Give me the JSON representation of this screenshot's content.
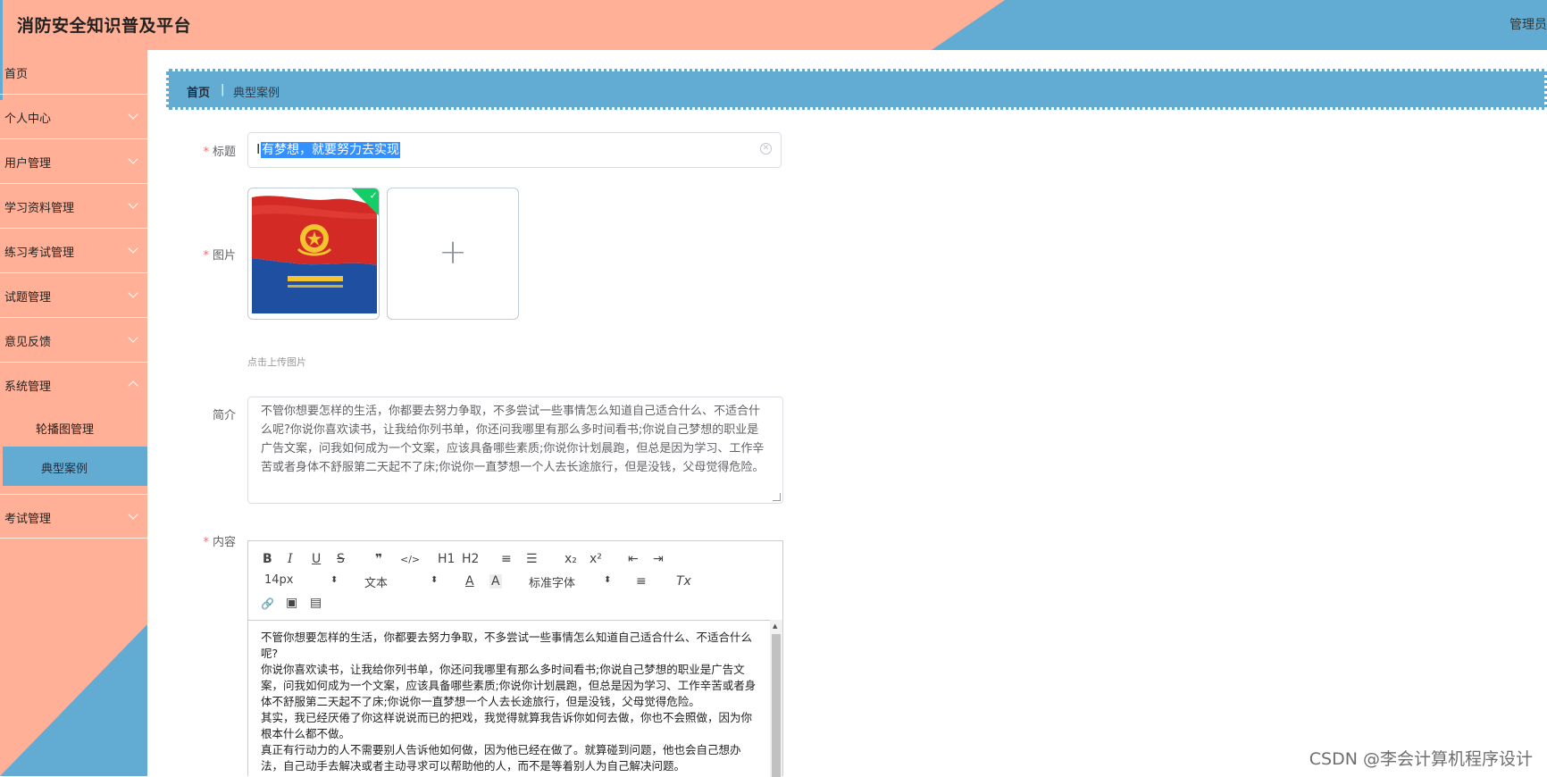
{
  "header": {
    "title": "消防安全知识普及平台",
    "user": "管理员"
  },
  "sidebar": {
    "items": [
      {
        "label": "首页"
      },
      {
        "label": "个人中心"
      },
      {
        "label": "用户管理"
      },
      {
        "label": "学习资料管理"
      },
      {
        "label": "练习考试管理"
      },
      {
        "label": "试题管理"
      },
      {
        "label": "意见反馈"
      },
      {
        "label": "系统管理"
      }
    ],
    "sub_items": [
      {
        "label": "轮播图管理"
      },
      {
        "label": "典型案例"
      }
    ],
    "last_item": {
      "label": "考试管理"
    }
  },
  "breadcrumb": {
    "home": "首页",
    "separator": "|",
    "current": "典型案例"
  },
  "form": {
    "title_label": "标题",
    "title_value": "有梦想，就要努力去实现",
    "image_label": "图片",
    "upload_tip": "点击上传图片",
    "intro_label": "简介",
    "intro_value": "不管你想要怎样的生活，你都要去努力争取，不多尝试一些事情怎么知道自己适合什么、不适合什么呢?你说你喜欢读书，让我给你列书单，你还问我哪里有那么多时间看书;你说自己梦想的职业是广告文案，问我如何成为一个文案，应该具备哪些素质;你说你计划晨跑，但总是因为学习、工作辛苦或者身体不舒服第二天起不了床;你说你一直梦想一个人去长途旅行，但是没钱，父母觉得危险。",
    "content_label": "内容",
    "required_mark": "*"
  },
  "editor": {
    "font_size": "14px",
    "header_select": "文本",
    "font_family": "标准字体",
    "buttons": {
      "bold": "B",
      "italic": "I",
      "underline": "U",
      "strike": "S",
      "blockquote": "❞",
      "code": "</>",
      "h1": "H1",
      "h2": "H2",
      "ordered_list": "≡",
      "bullet_list": "☰",
      "subscript": "x₂",
      "superscript": "x²",
      "outdent": "⇤",
      "indent": "⇥",
      "color": "A",
      "background": "A",
      "align": "≡",
      "clean": "Tx",
      "link": "🔗",
      "image": "▣",
      "video": "▤"
    },
    "paragraphs": [
      {
        "text": "不管你想要怎样的生活，你都要去努力争取，不多尝试一些事情怎么知道自己适合什么、不适合什么呢?",
        "bold": false
      },
      {
        "text": "你说你喜欢读书，让我给你列书单，你还问我哪里有那么多时间看书;你说自己梦想的职业是广告文案，问我如何成为一个文案，应该具备哪些素质;你说你计划晨跑，但总是因为学习、工作辛苦或者身体不舒服第二天起不了床;你说你一直梦想一个人去长途旅行，但是没钱，父母觉得危险。",
        "bold": false
      },
      {
        "text": "其实，我已经厌倦了你这样说说而已的把戏，我觉得就算我告诉你如何去做，你也不会照做，因为你根本什么都不做。",
        "bold": false
      },
      {
        "text": "真正有行动力的人不需要别人告诉他如何做，因为他已经在做了。就算碰到问题，他也会自己想办法，自己动手去解决或者主动寻求可以帮助他的人，而不是等着别人为自己解决问题。",
        "bold": false
      }
    ]
  },
  "watermark": "CSDN @李会计算机程序设计",
  "colors": {
    "salmon": "#ffb096",
    "blue": "#62acd3",
    "required": "#f56c6c",
    "success": "#13ce66"
  }
}
